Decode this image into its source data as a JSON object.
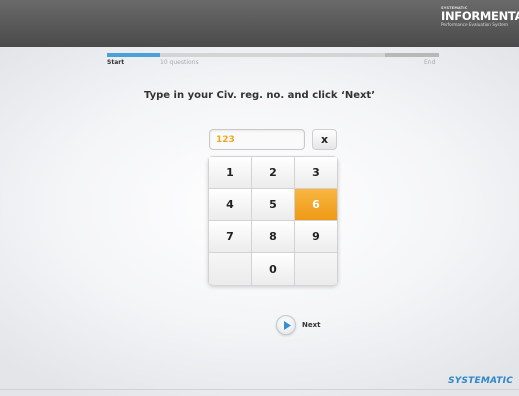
{
  "header": {
    "brand_small": "SYSTEMATIC",
    "brand_name": "INFORMENTAS",
    "brand_tagline": "Performance Evaluation System"
  },
  "progress": {
    "start_label": "Start",
    "middle_label": "10 questions",
    "end_label": "End",
    "fraction": 0.16
  },
  "instruction": "Type in your Civ. reg. no. and click ‘Next’",
  "input": {
    "value": "123"
  },
  "clear_label": "x",
  "keypad": {
    "keys": [
      "1",
      "2",
      "3",
      "4",
      "5",
      "6",
      "7",
      "8",
      "9",
      "",
      "0",
      ""
    ],
    "active_key": "6"
  },
  "next_label": "Next",
  "footer": {
    "logo": "SYSTEMATIC"
  },
  "colors": {
    "accent": "#f5a623",
    "progress": "#4aa0d8",
    "brand_blue": "#2f86c8"
  }
}
